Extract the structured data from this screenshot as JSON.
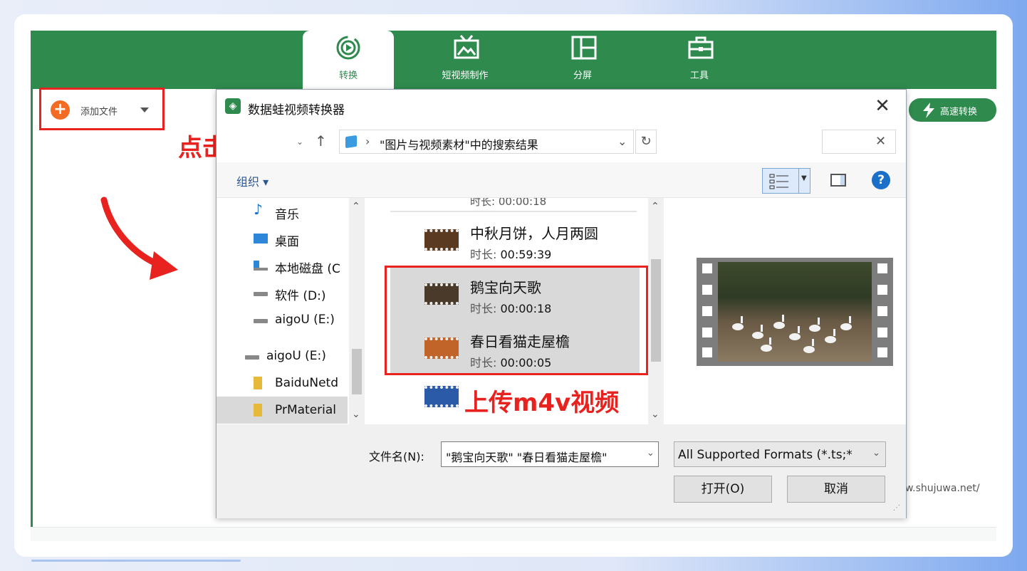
{
  "app": {
    "tabs": [
      {
        "label": "转换",
        "icon": "convert-icon"
      },
      {
        "label": "短视频制作",
        "icon": "tv-icon"
      },
      {
        "label": "分屏",
        "icon": "split-screen-icon"
      },
      {
        "label": "工具",
        "icon": "toolbox-icon"
      }
    ],
    "add_file_label": "添加文件",
    "speed_label": "高速转换",
    "url_text": "w.shujuwa.net/"
  },
  "annotations": {
    "click_hint": "点击按钮",
    "upload_hint": "上传m4v视频"
  },
  "dialog": {
    "title": "数据蛙视频转换器",
    "address_path": "\"图片与视频素材\"中的搜索结果",
    "organize_label": "组织",
    "nav_items": [
      {
        "label": "音乐",
        "icon": "music-icon"
      },
      {
        "label": "桌面",
        "icon": "desktop-icon"
      },
      {
        "label": "本地磁盘 (C",
        "icon": "local-disk-icon"
      },
      {
        "label": "软件 (D:)",
        "icon": "drive-icon"
      },
      {
        "label": "aigoU (E:)",
        "icon": "drive-icon"
      },
      {
        "label": "aigoU (E:)",
        "icon": "drive-icon"
      },
      {
        "label": "BaiduNetd",
        "icon": "folder-icon"
      },
      {
        "label": "PrMaterial",
        "icon": "folder-icon"
      }
    ],
    "files": [
      {
        "name": "中秋月饼，人月两圆",
        "duration_label": "时长:",
        "duration": "00:59:39",
        "selected": false
      },
      {
        "name": "鹅宝向天歌",
        "duration_label": "时长:",
        "duration": "00:00:18",
        "selected": true
      },
      {
        "name": "春日看猫走屋檐",
        "duration_label": "时长:",
        "duration": "00:00:05",
        "selected": true
      }
    ],
    "cut_top_text": "时长: 00:00:18",
    "filename_label": "文件名(N):",
    "filename_value": "\"鹅宝向天歌\" \"春日看猫走屋檐\"",
    "format_value": "All Supported Formats (*.ts;*",
    "open_label": "打开(O)",
    "cancel_label": "取消"
  },
  "colors": {
    "brand_green": "#2f8a4e",
    "annotation_red": "#e8231f",
    "add_orange": "#f36c24"
  }
}
